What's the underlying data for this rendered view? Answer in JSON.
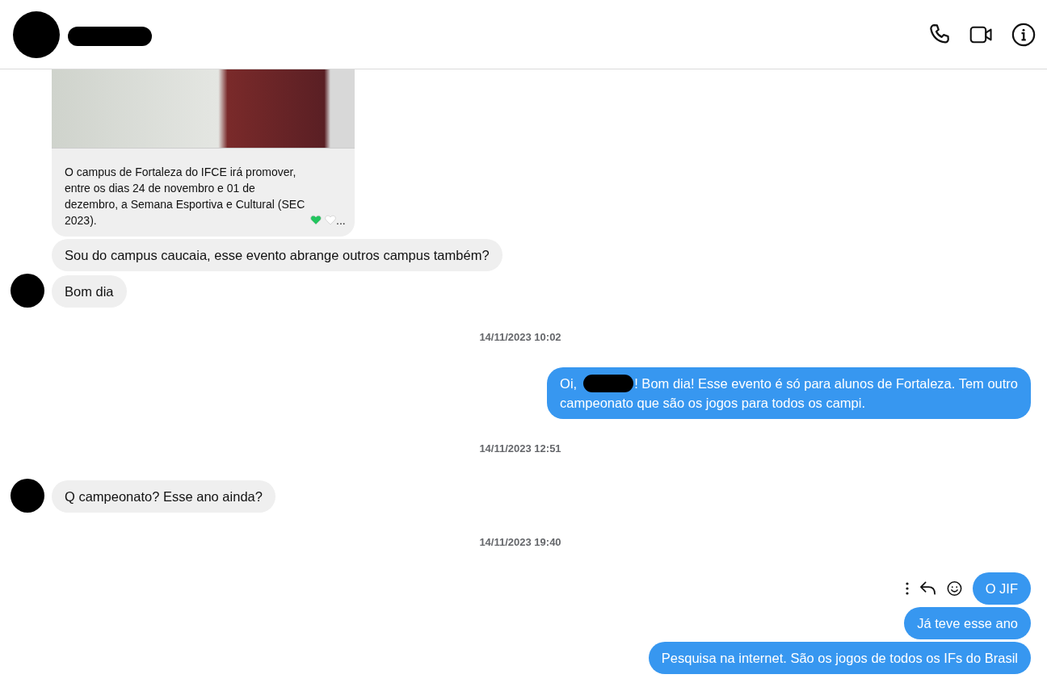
{
  "header": {
    "actions": [
      {
        "kind": "phone"
      },
      {
        "kind": "video"
      },
      {
        "kind": "info"
      }
    ]
  },
  "messages": [
    {
      "kind": "shared_post",
      "caption": "O campus de Fortaleza do IFCE irá promover, entre os dias 24 de novembro e 01 de dezembro, a Semana Esportiva e Cultural (SEC 2023).",
      "hearts": [
        {
          "color": "#22c55e"
        },
        {
          "color": "#ffffff"
        }
      ],
      "ellipsis": "..."
    },
    {
      "kind": "incoming",
      "text": "Sou do campus caucaia, esse evento abrange outros campus também?",
      "avatar": false
    },
    {
      "kind": "incoming",
      "text": "Bom dia",
      "avatar": true
    },
    {
      "kind": "timestamp",
      "text": "14/11/2023 10:02"
    },
    {
      "kind": "outgoing",
      "lines": [
        [
          {
            "kind": "text",
            "text": "Oi,"
          },
          {
            "kind": "redaction"
          },
          {
            "kind": "text",
            "text": "! Bom dia! Esse evento é só para alunos de Fortaleza. Tem outro"
          }
        ],
        [
          {
            "kind": "text",
            "text": "campeonato que são os jogos para todos os campi."
          }
        ]
      ],
      "actions": false
    },
    {
      "kind": "timestamp",
      "text": "14/11/2023 12:51"
    },
    {
      "kind": "incoming",
      "text": "Q campeonato? Esse ano ainda?",
      "avatar": true
    },
    {
      "kind": "timestamp",
      "text": "14/11/2023 19:40"
    },
    {
      "kind": "outgoing",
      "lines": [
        [
          {
            "kind": "text",
            "text": "O JIF"
          }
        ]
      ],
      "actions": true
    },
    {
      "kind": "outgoing",
      "lines": [
        [
          {
            "kind": "text",
            "text": "Já teve esse ano"
          }
        ]
      ],
      "actions": false
    },
    {
      "kind": "outgoing",
      "lines": [
        [
          {
            "kind": "text",
            "text": "Pesquisa na internet. São os jogos de todos os IFs do Brasil"
          }
        ]
      ],
      "actions": false
    }
  ]
}
